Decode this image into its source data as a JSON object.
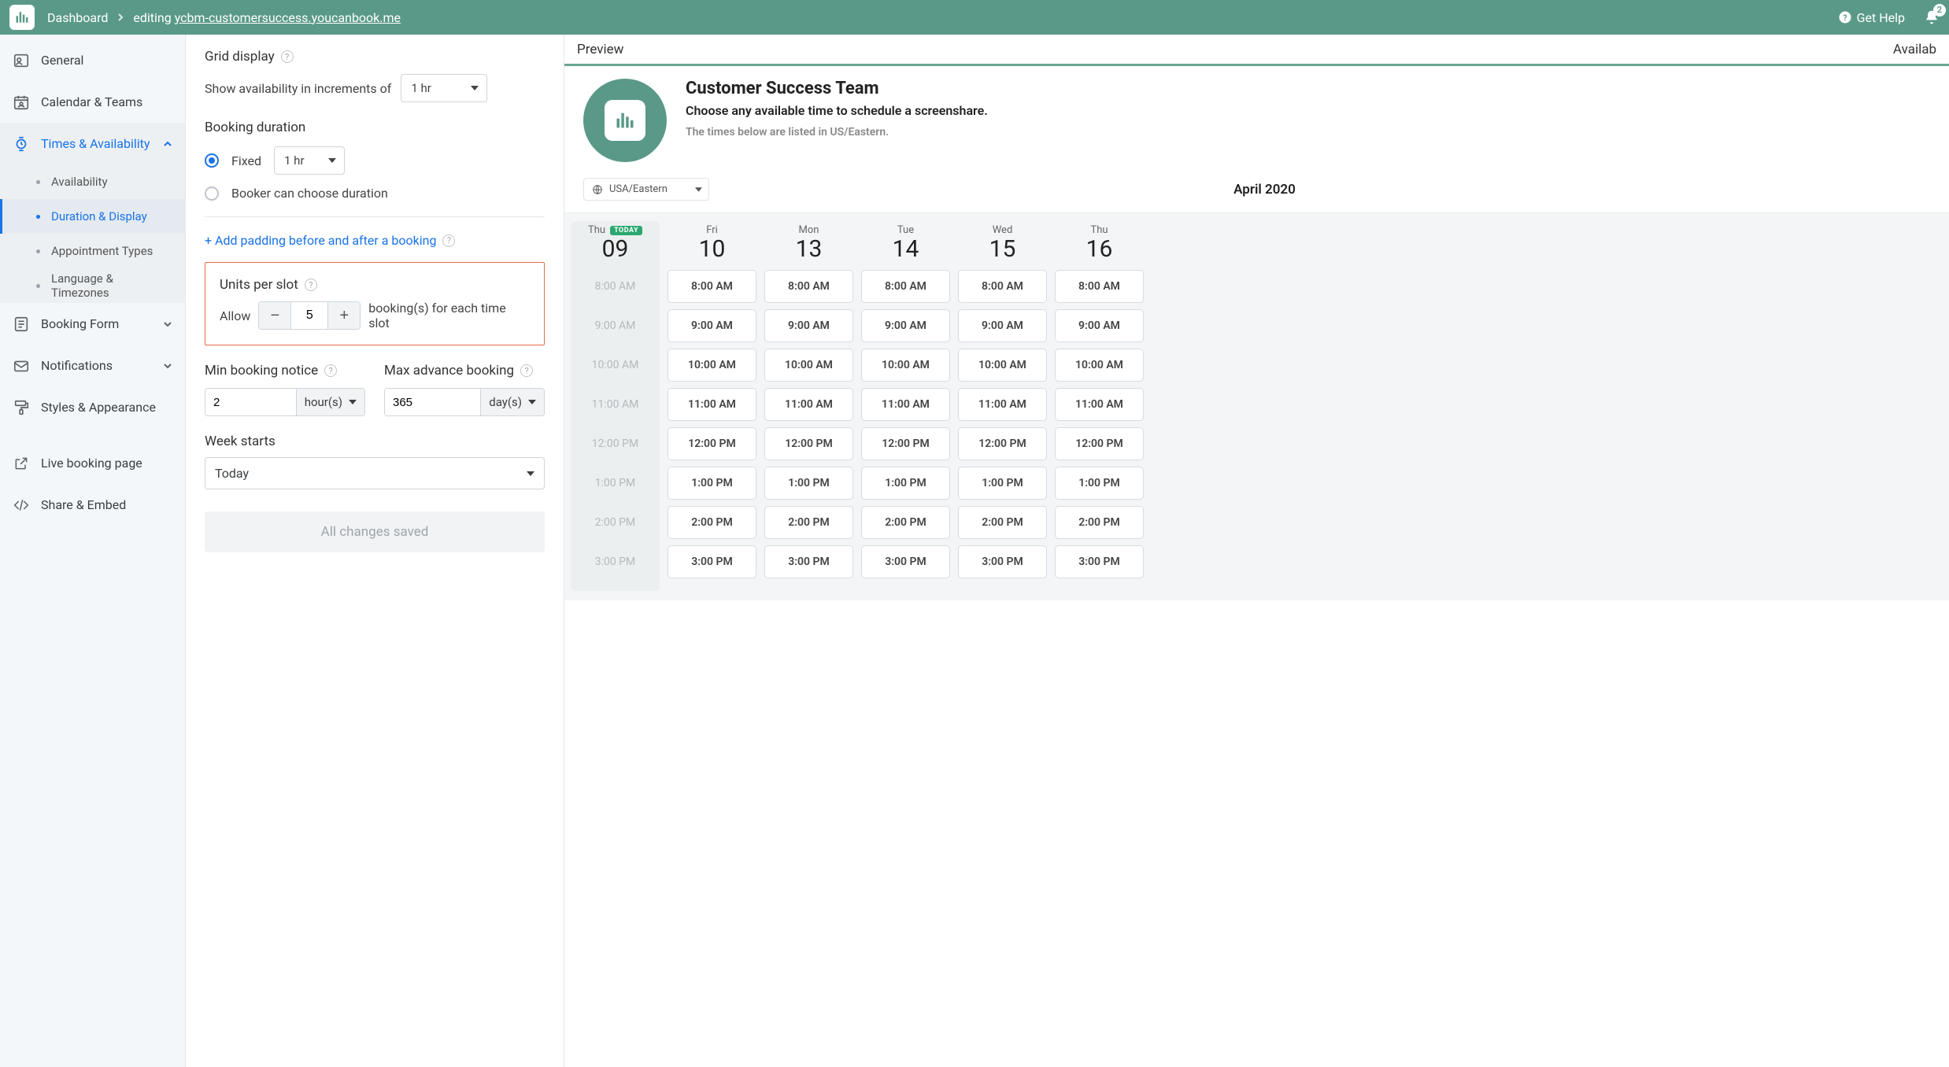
{
  "header": {
    "dashboard": "Dashboard",
    "editing_prefix": "editing",
    "url": "ycbm-customersuccess.youcanbook.me",
    "get_help": "Get Help",
    "notif_count": "2"
  },
  "sidebar": {
    "general": "General",
    "calendar_teams": "Calendar & Teams",
    "times_avail": "Times & Availability",
    "availability": "Availability",
    "duration_display": "Duration & Display",
    "appt_types": "Appointment Types",
    "lang_tz": "Language & Timezones",
    "booking_form": "Booking Form",
    "notifications": "Notifications",
    "styles": "Styles & Appearance",
    "live_page": "Live booking page",
    "share_embed": "Share & Embed"
  },
  "settings": {
    "grid_display": "Grid display",
    "show_incr": "Show availability in increments of",
    "incr_value": "1 hr",
    "booking_duration": "Booking duration",
    "fixed": "Fixed",
    "fixed_value": "1 hr",
    "booker_choose": "Booker can choose duration",
    "add_padding": "+ Add padding before and after a booking",
    "units_per_slot": "Units per slot",
    "allow": "Allow",
    "units_value": "5",
    "units_suffix": "booking(s) for each time slot",
    "min_notice": "Min booking notice",
    "min_value": "2",
    "min_unit": "hour(s)",
    "max_advance": "Max advance booking",
    "max_value": "365",
    "max_unit": "day(s)",
    "week_starts": "Week starts",
    "week_value": "Today",
    "saved": "All changes saved"
  },
  "preview": {
    "tab_preview": "Preview",
    "tab_avail": "Availab",
    "title": "Customer Success Team",
    "subtitle": "Choose any available time to schedule a screenshare.",
    "note": "The times below are listed in US/Eastern.",
    "tz": "USA/Eastern",
    "month": "April 2020",
    "today_badge": "TODAY",
    "days": [
      {
        "dow": "Thu",
        "num": "09",
        "today": true,
        "disabled": true
      },
      {
        "dow": "Fri",
        "num": "10"
      },
      {
        "dow": "Mon",
        "num": "13"
      },
      {
        "dow": "Tue",
        "num": "14"
      },
      {
        "dow": "Wed",
        "num": "15"
      },
      {
        "dow": "Thu",
        "num": "16"
      }
    ],
    "slots": [
      "8:00 AM",
      "9:00 AM",
      "10:00 AM",
      "11:00 AM",
      "12:00 PM",
      "1:00 PM",
      "2:00 PM",
      "3:00 PM"
    ]
  }
}
